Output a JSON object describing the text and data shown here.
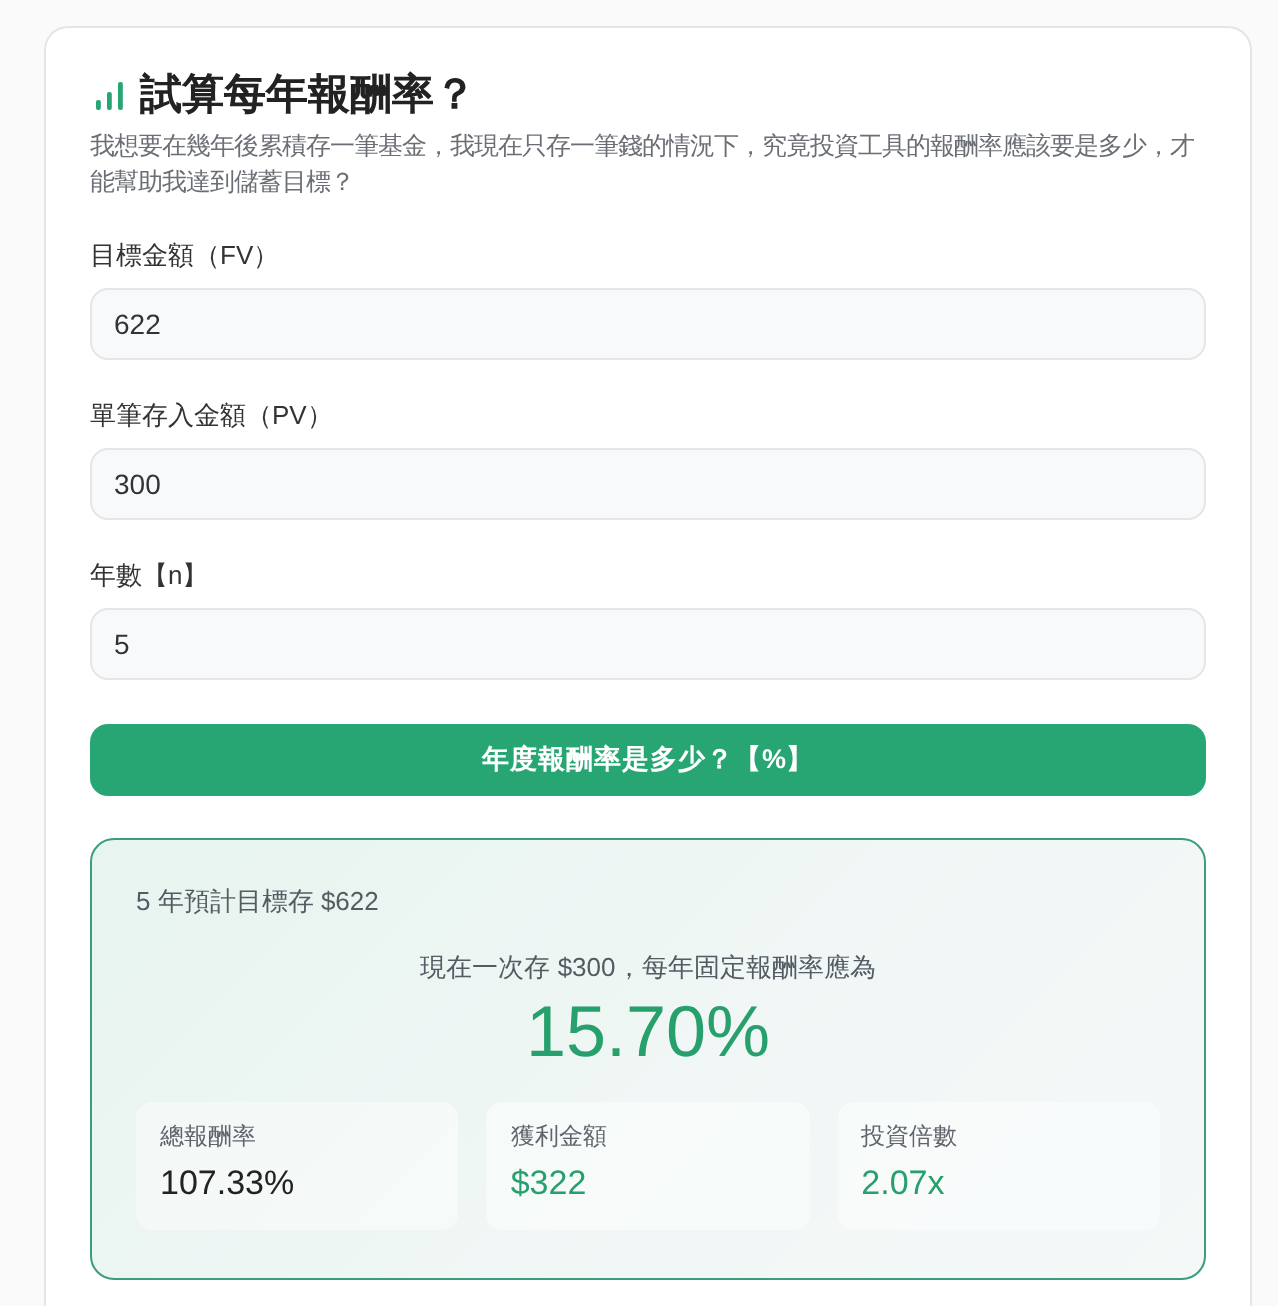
{
  "header": {
    "title": "試算每年報酬率？",
    "description": "我想要在幾年後累積存一筆基金，我現在只存一筆錢的情況下，究竟投資工具的報酬率應該要是多少，才能幫助我達到儲蓄目標？"
  },
  "fields": [
    {
      "label": "目標金額（FV）",
      "value": "622"
    },
    {
      "label": "單筆存入金額（PV）",
      "value": "300"
    },
    {
      "label": "年數【n】",
      "value": "5"
    }
  ],
  "calculate_button": "年度報酬率是多少？【%】",
  "result": {
    "summary": "5 年預計目標存 $622",
    "caption": "現在一次存 $300，每年固定報酬率應為",
    "rate": "15.70%",
    "stats": [
      {
        "label": "總報酬率",
        "value": "107.33%",
        "accent": false
      },
      {
        "label": "獲利金額",
        "value": "$322",
        "accent": true
      },
      {
        "label": "投資倍數",
        "value": "2.07x",
        "accent": true
      }
    ]
  }
}
